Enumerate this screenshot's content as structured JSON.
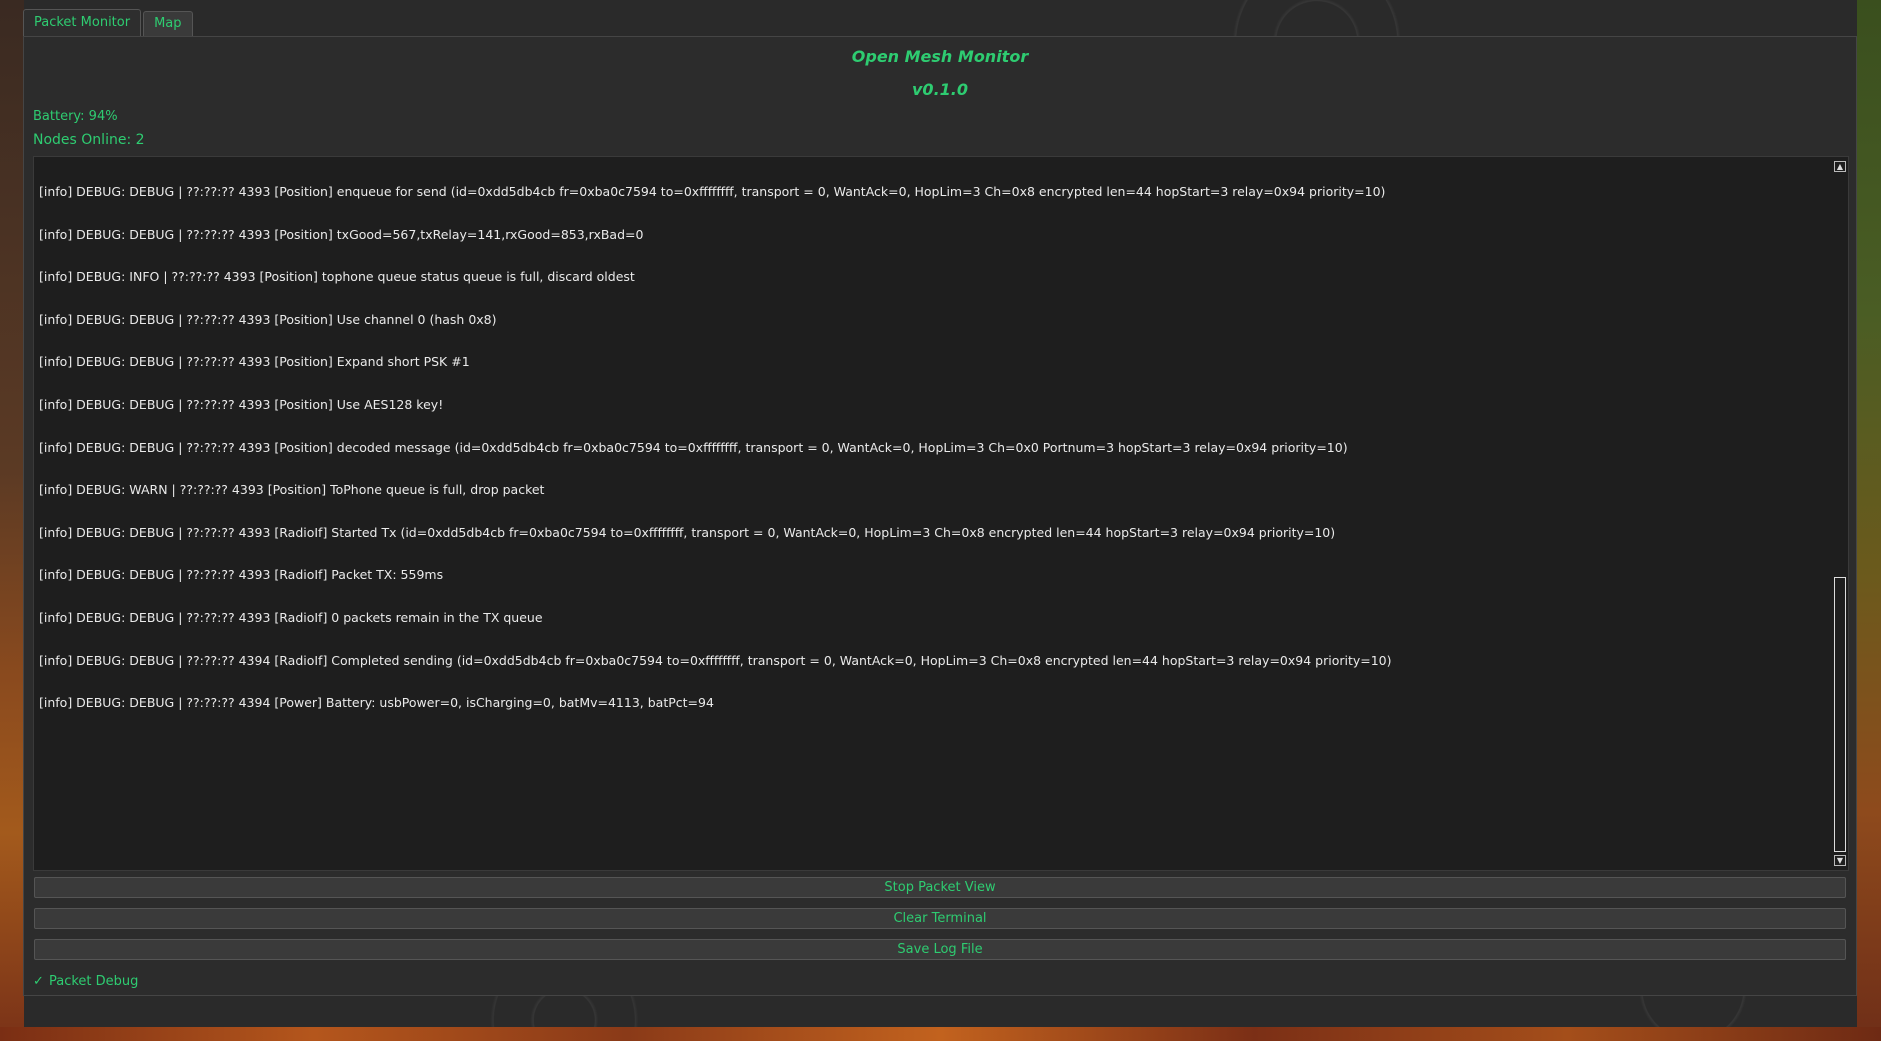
{
  "tabs": [
    {
      "label": "Packet Monitor"
    },
    {
      "label": "Map"
    }
  ],
  "header": {
    "title": "Open Mesh Monitor",
    "version": "v0.1.0"
  },
  "status": {
    "battery": "Battery: 94%",
    "nodes_online": "Nodes Online: 2"
  },
  "log": [
    "[info] DEBUG: DEBUG | ??:??:?? 4393 [Position] enqueue for send (id=0xdd5db4cb fr=0xba0c7594 to=0xffffffff, transport = 0, WantAck=0, HopLim=3 Ch=0x8 encrypted len=44 hopStart=3 relay=0x94 priority=10)",
    "[info] DEBUG: DEBUG | ??:??:?? 4393 [Position] txGood=567,txRelay=141,rxGood=853,rxBad=0",
    "[info] DEBUG: INFO  | ??:??:?? 4393 [Position] tophone queue status queue is full, discard oldest",
    "[info] DEBUG: DEBUG | ??:??:?? 4393 [Position] Use channel 0 (hash 0x8)",
    "[info] DEBUG: DEBUG | ??:??:?? 4393 [Position] Expand short PSK #1",
    "[info] DEBUG: DEBUG | ??:??:?? 4393 [Position] Use AES128 key!",
    "[info] DEBUG: DEBUG | ??:??:?? 4393 [Position] decoded message (id=0xdd5db4cb fr=0xba0c7594 to=0xffffffff, transport = 0, WantAck=0, HopLim=3 Ch=0x0 Portnum=3 hopStart=3 relay=0x94 priority=10)",
    "[info] DEBUG: WARN  | ??:??:?? 4393 [Position] ToPhone queue is full, drop packet",
    "[info] DEBUG: DEBUG | ??:??:?? 4393 [RadioIf] Started Tx (id=0xdd5db4cb fr=0xba0c7594 to=0xffffffff, transport = 0, WantAck=0, HopLim=3 Ch=0x8 encrypted len=44 hopStart=3 relay=0x94 priority=10)",
    "[info] DEBUG: DEBUG | ??:??:?? 4393 [RadioIf] Packet TX: 559ms",
    "[info] DEBUG: DEBUG | ??:??:?? 4393 [RadioIf] 0 packets remain in the TX queue",
    "[info] DEBUG: DEBUG | ??:??:?? 4394 [RadioIf] Completed sending (id=0xdd5db4cb fr=0xba0c7594 to=0xffffffff, transport = 0, WantAck=0, HopLim=3 Ch=0x8 encrypted len=44 hopStart=3 relay=0x94 priority=10)",
    "[info] DEBUG: DEBUG | ??:??:?? 4394 [Power] Battery: usbPower=0, isCharging=0, batMv=4113, batPct=94"
  ],
  "buttons": {
    "stop": "Stop Packet View",
    "clear": "Clear Terminal",
    "save": "Save Log File"
  },
  "packet_debug": {
    "label": "Packet Debug",
    "checked": true,
    "check_glyph": "✓"
  },
  "scrollbar": {
    "up_glyph": "▲",
    "down_glyph": "▼"
  },
  "colors": {
    "accent": "#2ecc71",
    "terminal_bg": "#1e1e1e",
    "text": "#eaeaea"
  }
}
